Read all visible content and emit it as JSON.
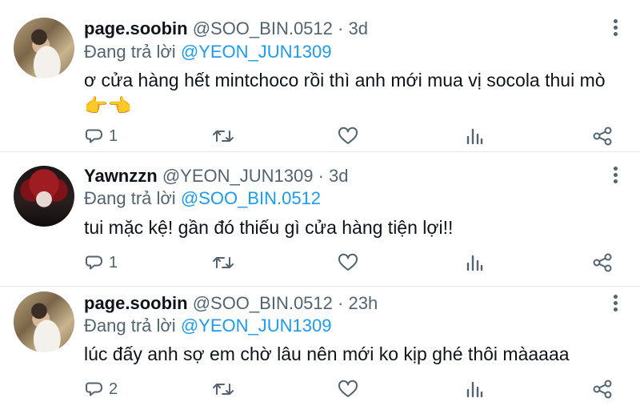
{
  "tweets": [
    {
      "name": "page.soobin",
      "handle": "@SOO_BIN.0512",
      "dot": "·",
      "time": "3d",
      "reply_prefix": "Đang trả lời",
      "reply_to": "@YEON_JUN1309",
      "text": "ơ cửa hàng hết mintchoco rồi thì anh mới mua vị socola thui mò",
      "emoji": "👉👈",
      "reply_count": "1",
      "avatar": "soobin"
    },
    {
      "name": "Yawnzzn",
      "handle": "@YEON_JUN1309",
      "dot": "·",
      "time": "3d",
      "reply_prefix": "Đang trả lời",
      "reply_to": "@SOO_BIN.0512",
      "text": "tui mặc kệ! gần đó thiếu gì cửa hàng tiện lợi!!",
      "emoji": "",
      "reply_count": "1",
      "avatar": "yawn"
    },
    {
      "name": "page.soobin",
      "handle": "@SOO_BIN.0512",
      "dot": "·",
      "time": "23h",
      "reply_prefix": "Đang trả lời",
      "reply_to": "@YEON_JUN1309",
      "text": "lúc đấy anh sợ em chờ lâu nên mới ko kịp ghé thôi màaaaa",
      "emoji": "",
      "reply_count": "2",
      "avatar": "soobin"
    }
  ],
  "icons": {
    "reply": "reply-icon",
    "retweet": "retweet-icon",
    "like": "heart-icon",
    "analytics": "analytics-icon",
    "share": "share-icon",
    "more": "more-vertical-icon"
  },
  "colors": {
    "text": "#0f1419",
    "secondary": "#536471",
    "link": "#1d9bf0",
    "divider": "#e6ecf0"
  }
}
